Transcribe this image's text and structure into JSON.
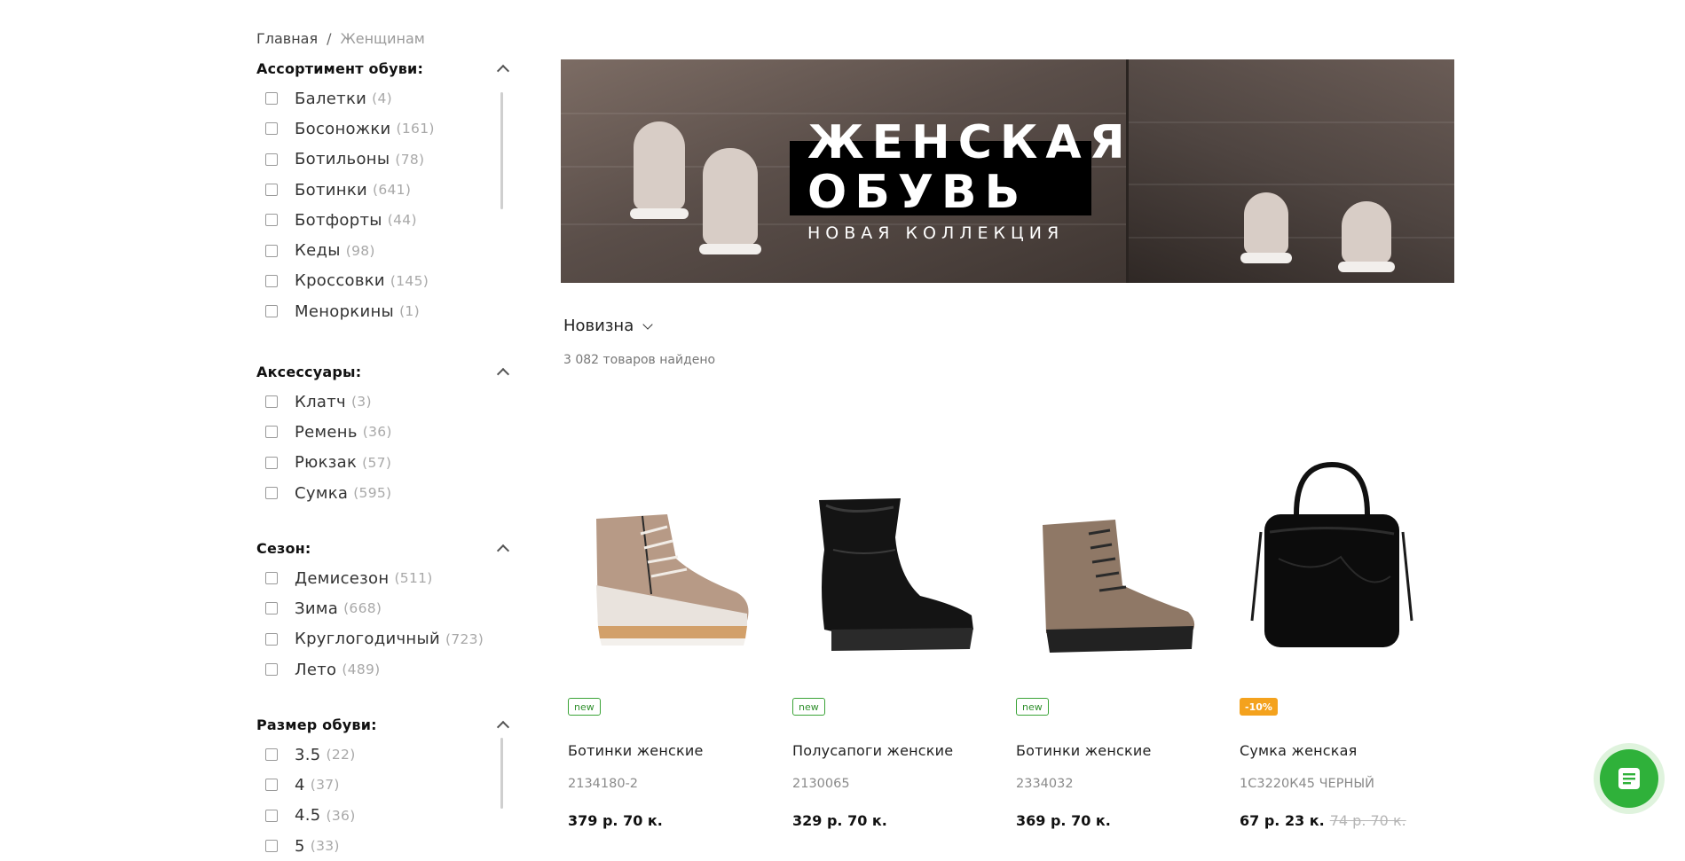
{
  "breadcrumb": {
    "home": "Главная",
    "separator": "/",
    "current": "Женщинам"
  },
  "filters": [
    {
      "title": "Ассортимент обуви:",
      "items": [
        {
          "label": "Балетки",
          "count": "(4)"
        },
        {
          "label": "Босоножки",
          "count": "(161)"
        },
        {
          "label": "Ботильоны",
          "count": "(78)"
        },
        {
          "label": "Ботинки",
          "count": "(641)"
        },
        {
          "label": "Ботфорты",
          "count": "(44)"
        },
        {
          "label": "Кеды",
          "count": "(98)"
        },
        {
          "label": "Кроссовки",
          "count": "(145)"
        },
        {
          "label": "Меноркины",
          "count": "(1)"
        }
      ]
    },
    {
      "title": "Аксессуары:",
      "items": [
        {
          "label": "Клатч",
          "count": "(3)"
        },
        {
          "label": "Ремень",
          "count": "(36)"
        },
        {
          "label": "Рюкзак",
          "count": "(57)"
        },
        {
          "label": "Сумка",
          "count": "(595)"
        }
      ]
    },
    {
      "title": "Сезон:",
      "items": [
        {
          "label": "Демисезон",
          "count": "(511)"
        },
        {
          "label": "Зима",
          "count": "(668)"
        },
        {
          "label": "Круглогодичный",
          "count": "(723)"
        },
        {
          "label": "Лето",
          "count": "(489)"
        }
      ]
    },
    {
      "title": "Размер обуви:",
      "items": [
        {
          "label": "3.5",
          "count": "(22)"
        },
        {
          "label": "4",
          "count": "(37)"
        },
        {
          "label": "4.5",
          "count": "(36)"
        },
        {
          "label": "5",
          "count": "(33)"
        }
      ]
    }
  ],
  "banner": {
    "line1": "ЖЕНСКАЯ",
    "line2": "ОБУВЬ",
    "subtitle": "НОВАЯ КОЛЛЕКЦИЯ"
  },
  "sort": {
    "label": "Новизна"
  },
  "results": {
    "found": "3 082 товаров найдено"
  },
  "products": [
    {
      "badge": "new",
      "badge_type": "new",
      "title": "Ботинки женские",
      "sku": "2134180-2",
      "price": "379 р. 70 к.",
      "old_price": ""
    },
    {
      "badge": "new",
      "badge_type": "new",
      "title": "Полусапоги женские",
      "sku": "2130065",
      "price": "329 р. 70 к.",
      "old_price": ""
    },
    {
      "badge": "new",
      "badge_type": "new",
      "title": "Ботинки женские",
      "sku": "2334032",
      "price": "369 р. 70 к.",
      "old_price": ""
    },
    {
      "badge": "-10%",
      "badge_type": "sale",
      "title": "Сумка женская",
      "sku": "1С3220К45 ЧЕРНЫЙ",
      "price": "67 р. 23 к.",
      "old_price": "74 р. 70 к."
    }
  ],
  "colors": {
    "accent_green": "#2fb13a",
    "sale_orange": "#f4a21d",
    "new_green": "#3aa336"
  },
  "icons": {
    "chat": "chat-document-icon",
    "collapse": "chevron-up-icon",
    "sort": "chevron-down-icon"
  }
}
